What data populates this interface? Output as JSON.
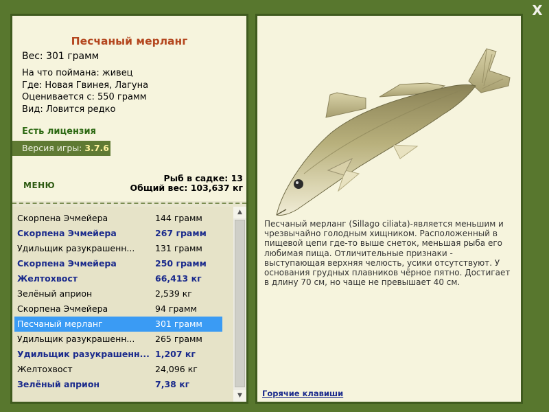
{
  "close_button": "X",
  "fish": {
    "title": "Песчаный мерланг",
    "weight": "Вес: 301 грамм",
    "caught_on": "На что поймана: живец",
    "location": "Где: Новая Гвинея, Лагуна",
    "valued_from": "Оценивается с: 550 грамм",
    "rarity": "Вид: Ловится редко"
  },
  "license": "Есть лицензия",
  "version": {
    "label": "Версия игры:",
    "value": "3.7.6"
  },
  "menu": "МЕНЮ",
  "stats": {
    "fish_count": "Рыб в садке: 13",
    "total_weight": "Общий вес: 103,637 кг"
  },
  "catch_list": [
    {
      "name": "Скорпена Эчмейера",
      "weight": "144 грамм",
      "bold": false,
      "selected": false
    },
    {
      "name": "Скорпена Эчмейера",
      "weight": "267 грамм",
      "bold": true,
      "selected": false
    },
    {
      "name": "Удильщик разукрашенн...",
      "weight": "131 грамм",
      "bold": false,
      "selected": false
    },
    {
      "name": "Скорпена Эчмейера",
      "weight": "250 грамм",
      "bold": true,
      "selected": false
    },
    {
      "name": "Желтохвост",
      "weight": "66,413 кг",
      "bold": true,
      "selected": false
    },
    {
      "name": "Зелёный априон",
      "weight": "2,539 кг",
      "bold": false,
      "selected": false
    },
    {
      "name": "Скорпена Эчмейера",
      "weight": "94 грамм",
      "bold": false,
      "selected": false
    },
    {
      "name": "Песчаный мерланг",
      "weight": "301 грамм",
      "bold": false,
      "selected": true
    },
    {
      "name": "Удильщик разукрашенн...",
      "weight": "265 грамм",
      "bold": false,
      "selected": false
    },
    {
      "name": "Удильщик разукрашенн...",
      "weight": "1,207 кг",
      "bold": true,
      "selected": false
    },
    {
      "name": "Желтохвост",
      "weight": "24,096 кг",
      "bold": false,
      "selected": false
    },
    {
      "name": "Зелёный априон",
      "weight": "7,38 кг",
      "bold": true,
      "selected": false
    }
  ],
  "description": "Песчаный мерланг (Sillago ciliata)-является меньшим и чрезвычайно голодным хищником. Расположенный в пищевой цепи где-то выше снеток, меньшая рыба его любимая пища. Отличительные признаки - выступающая верхняя челюсть, усики отсутствуют. У основания грудных плавников чёрное пятно. Достигает в длину 70 см, но чаще не превышает 40 см.",
  "hotkeys": "Горячие клавиши",
  "colors": {
    "background": "#58772e",
    "title": "#b4471f",
    "license": "#2e6a14",
    "bold_row": "#1a2a8c",
    "selection": "#3a9bf4"
  },
  "icons": {
    "close": "close-icon",
    "scroll_up": "arrow-up-icon",
    "scroll_down": "arrow-down-icon"
  }
}
